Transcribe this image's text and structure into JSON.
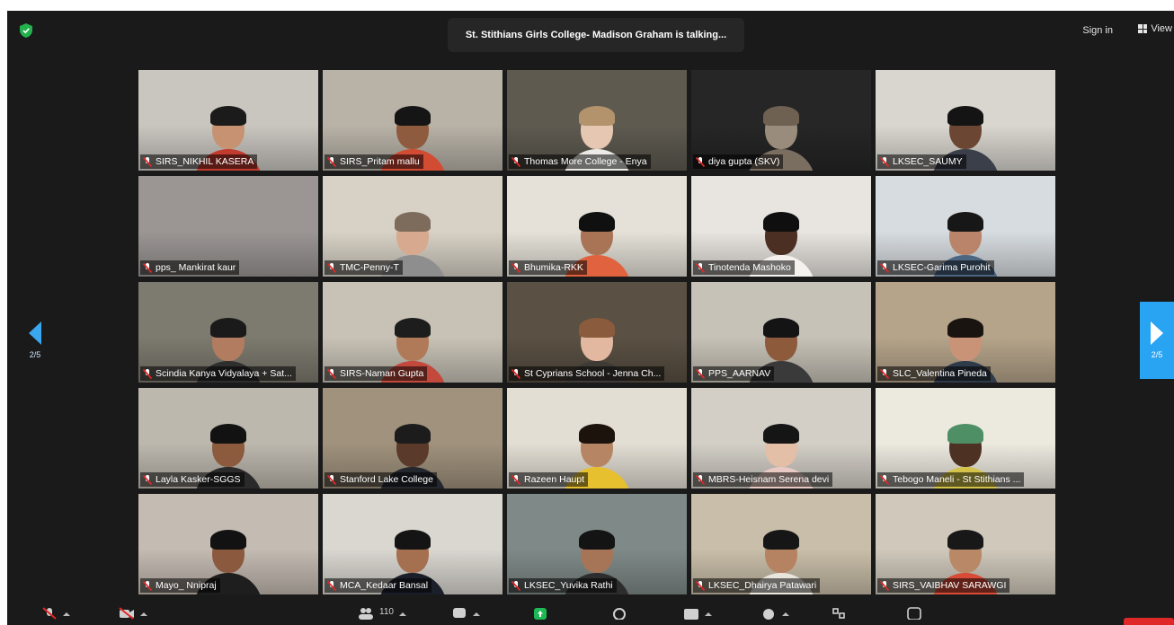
{
  "meeting": {
    "talking_status": "St. Stithians Girls College- Madison Graham is talking...",
    "sign_in_label": "Sign in",
    "view_label": "View",
    "page_indicator": "2/5",
    "participants_count": "110"
  },
  "colors": {
    "window_bg": "#1a1a1a",
    "accent_blue": "#29a4f2",
    "mute_red": "#e02828",
    "shield_green": "#23b14d",
    "share_green": "#1db954"
  },
  "participants": [
    {
      "name": "SIRS_NIKHIL KASERA",
      "bg": "#c9c6c0",
      "skin": "#c69272",
      "hair": "#1b1b1b",
      "shirt": "#c33a2f"
    },
    {
      "name": "SIRS_Pritam mallu",
      "bg": "#b8b2a7",
      "skin": "#8f5b3f",
      "hair": "#151515",
      "shirt": "#d24b33"
    },
    {
      "name": "Thomas More College - Enya",
      "bg": "#5e5a50",
      "skin": "#e5c7b2",
      "hair": "#b2936b",
      "shirt": "#eceae6"
    },
    {
      "name": "diya gupta (SKV)",
      "bg": "#262626",
      "skin": "#9a8c7c",
      "hair": "#6e6152",
      "shirt": "#7a6e60"
    },
    {
      "name": "LKSEC_SAUMY",
      "bg": "#d9d6cf",
      "skin": "#6b4632",
      "hair": "#141414",
      "shirt": "#3a3f4a"
    },
    {
      "name": "pps_ Mankirat kaur",
      "bg": "#9b9694",
      "skin": "#9b9694",
      "hair": "#9b9694",
      "shirt": "#9b9694"
    },
    {
      "name": "TMC-Penny-T",
      "bg": "#d8d2c6",
      "skin": "#d7a98e",
      "hair": "#7d6b5c",
      "shirt": "#8e8e8e"
    },
    {
      "name": "Bhumika-RKK",
      "bg": "#e5e1d8",
      "skin": "#a87455",
      "hair": "#101010",
      "shirt": "#e0623e"
    },
    {
      "name": "Tinotenda Mashoko",
      "bg": "#e8e5e0",
      "skin": "#4b2f22",
      "hair": "#0f0f0f",
      "shirt": "#f4f1ee"
    },
    {
      "name": "LKSEC-Garima Purohit",
      "bg": "#d7dce0",
      "skin": "#b9846a",
      "hair": "#171717",
      "shirt": "#4d6783"
    },
    {
      "name": "Scindia Kanya Vidyalaya + Sat...",
      "bg": "#7d7a6f",
      "skin": "#b17c5f",
      "hair": "#1a1a1a",
      "shirt": "#2e2e2e"
    },
    {
      "name": "SIRS-Naman Gupta",
      "bg": "#c8c2b6",
      "skin": "#b07a58",
      "hair": "#1d1d1d",
      "shirt": "#c2493c"
    },
    {
      "name": "St Cyprians School - Jenna Ch...",
      "bg": "#5a5043",
      "skin": "#e2b8a1",
      "hair": "#8a5b3c",
      "shirt": "#3e3a35"
    },
    {
      "name": "PPS_AARNAV",
      "bg": "#c7c2b7",
      "skin": "#8d5a3c",
      "hair": "#141414",
      "shirt": "#3a3a3a"
    },
    {
      "name": "SLC_Valentina Pineda",
      "bg": "#b5a48a",
      "skin": "#c99378",
      "hair": "#1a1410",
      "shirt": "#2f3a4a"
    },
    {
      "name": "Layla Kasker-SGGS",
      "bg": "#bdb8ae",
      "skin": "#8c5a3d",
      "hair": "#121212",
      "shirt": "#2a2a2a"
    },
    {
      "name": "Stanford Lake College",
      "bg": "#a0927d",
      "skin": "#5a3a2a",
      "hair": "#1c1c1c",
      "shirt": "#24272e"
    },
    {
      "name": "Razeen Haupt",
      "bg": "#e3ded4",
      "skin": "#b58564",
      "hair": "#1c130d",
      "shirt": "#e7c030"
    },
    {
      "name": "MBRS-Heisnam Serena devi",
      "bg": "#d3cfc7",
      "skin": "#e2bfa6",
      "hair": "#151515",
      "shirt": "#e9c9c4"
    },
    {
      "name": "Tebogo Maneli - St Stithians ...",
      "bg": "#ece9df",
      "skin": "#4d3224",
      "hair": "#4f8f66",
      "shirt": "#d4c34a"
    },
    {
      "name": "Mayo_ Nnipraj",
      "bg": "#c4bbb2",
      "skin": "#8a593e",
      "hair": "#121212",
      "shirt": "#1e1e1e"
    },
    {
      "name": "MCA_Kedaar Bansal",
      "bg": "#dad7d1",
      "skin": "#a4704f",
      "hair": "#141414",
      "shirt": "#1b1f2a"
    },
    {
      "name": "LKSEC_Yuvika Rathi",
      "bg": "#7f8a88",
      "skin": "#a67558",
      "hair": "#141414",
      "shirt": "#2d2d2d"
    },
    {
      "name": "LKSEC_Dhairya Patawari",
      "bg": "#c9bea9",
      "skin": "#b58361",
      "hair": "#161616",
      "shirt": "#e8e5dc"
    },
    {
      "name": "SIRS_VAIBHAV SARAWGI",
      "bg": "#cfc8bb",
      "skin": "#b98967",
      "hair": "#181818",
      "shirt": "#d84b37"
    }
  ],
  "toolbar": [
    {
      "icon": "microphone-muted-icon"
    },
    {
      "icon": "video-off-icon"
    },
    {
      "icon": "participants-icon",
      "count": "110"
    },
    {
      "icon": "chat-icon"
    },
    {
      "icon": "share-screen-icon"
    },
    {
      "icon": "record-icon"
    },
    {
      "icon": "captions-icon"
    },
    {
      "icon": "reactions-icon"
    },
    {
      "icon": "apps-icon"
    },
    {
      "icon": "more-icon"
    }
  ]
}
